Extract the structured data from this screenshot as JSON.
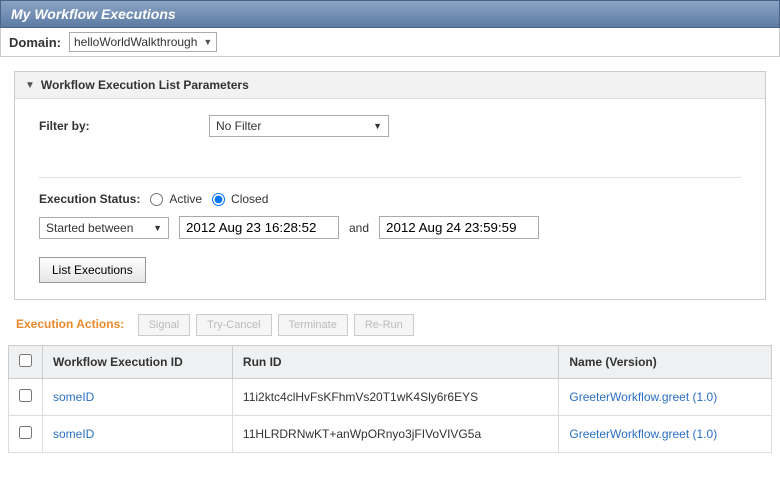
{
  "titleBar": "My Workflow Executions",
  "domain": {
    "label": "Domain:",
    "value": "helloWorldWalkthrough"
  },
  "paramsPanel": {
    "header": "Workflow Execution List Parameters",
    "filterBy": {
      "label": "Filter by:",
      "value": "No Filter"
    },
    "execStatusLabel": "Execution Status:",
    "statusActive": "Active",
    "statusClosed": "Closed",
    "statusSelected": "Closed",
    "dateMode": "Started between",
    "dateFrom": "2012 Aug 23 16:28:52",
    "dateJoiner": "and",
    "dateTo": "2012 Aug 24 23:59:59",
    "listBtn": "List Executions"
  },
  "actions": {
    "label": "Execution Actions:",
    "buttons": [
      "Signal",
      "Try-Cancel",
      "Terminate",
      "Re-Run"
    ]
  },
  "table": {
    "headers": [
      "",
      "Workflow Execution ID",
      "Run ID",
      "Name (Version)"
    ],
    "rows": [
      {
        "id": "someID",
        "runId": "11i2ktc4clHvFsKFhmVs20T1wK4Sly6r6EYS",
        "name": "GreeterWorkflow.greet (1.0)"
      },
      {
        "id": "someID",
        "runId": "11HLRDRNwKT+anWpORnyo3jFIVoVIVG5a",
        "name": "GreeterWorkflow.greet (1.0)"
      }
    ]
  }
}
